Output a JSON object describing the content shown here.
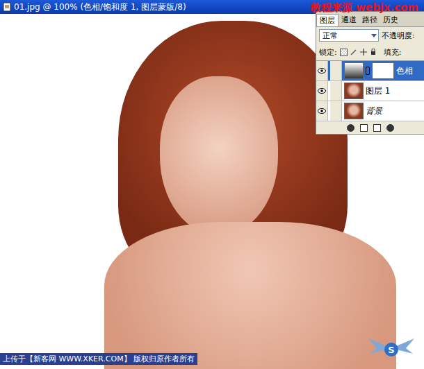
{
  "window": {
    "title": "01.jpg @ 100% (色相/饱和度 1, 图层蒙版/8)"
  },
  "watermark": "教程来源  webjx.com",
  "layers_panel": {
    "tabs": [
      {
        "label": "图层",
        "selected": true
      },
      {
        "label": "通道",
        "selected": false
      },
      {
        "label": "路径",
        "selected": false
      },
      {
        "label": "历史",
        "selected": false
      }
    ],
    "blend_mode": "正常",
    "opacity_label": "不透明度:",
    "lock_label": "锁定:",
    "fill_label": "填充:",
    "layers": [
      {
        "name": "色相",
        "kind": "adjustment",
        "visible": true,
        "selected": true
      },
      {
        "name": "图层 1",
        "kind": "pixel",
        "visible": true,
        "selected": false
      },
      {
        "name": "背景",
        "kind": "pixel",
        "visible": true,
        "selected": false
      }
    ]
  },
  "footer": "上传于【新客网 WWW.XKER.COM】 版权归原作者所有",
  "logo": "S"
}
